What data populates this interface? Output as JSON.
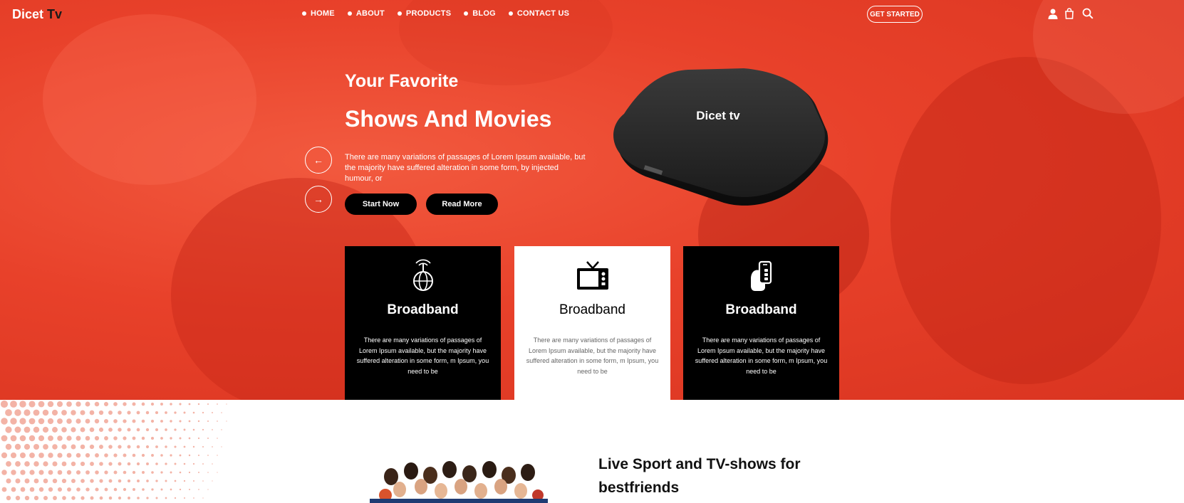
{
  "header": {
    "logo_main": "Dicet ",
    "logo_accent": "Tv",
    "nav": [
      {
        "label": "HOME"
      },
      {
        "label": "ABOUT"
      },
      {
        "label": "PRODUCTS"
      },
      {
        "label": "BLOG"
      },
      {
        "label": "CONTACT US"
      }
    ],
    "cta_label": "GET STARTED",
    "icons": [
      "user-icon",
      "cart-icon",
      "search-icon"
    ]
  },
  "hero": {
    "title_line1": "Your Favorite",
    "title_line2": "Shows And Movies",
    "description": "There are many variations of passages of Lorem Ipsum available, but the majority have suffered alteration in some form, by injected humour, or",
    "start_button": "Start Now",
    "read_button": "Read More",
    "prev_arrow": "←",
    "next_arrow": "→",
    "device_label": "Dicet tv"
  },
  "cards": [
    {
      "icon": "globe-antenna-icon",
      "title": "Broadband",
      "text": "There are many variations of passages of Lorem Ipsum available, but the majority have suffered alteration in some form, m Ipsum, you need to be"
    },
    {
      "icon": "tv-icon",
      "title": "Broadband",
      "text": "There are many variations of passages of Lorem Ipsum available, but the majority have suffered alteration in some form, m Ipsum, you need to be"
    },
    {
      "icon": "phone-hand-icon",
      "title": "Broadband",
      "text": "There are many variations of passages of Lorem Ipsum available, but the majority have suffered alteration in some form, m Ipsum, you need to be"
    }
  ],
  "section": {
    "title_line1": "Live Sport and TV-shows for",
    "title_line2": "bestfriends"
  },
  "colors": {
    "hero_red": "#e8412a",
    "card_dark": "#000000",
    "card_light": "#ffffff",
    "dot_pattern": "#f3b3a6"
  }
}
